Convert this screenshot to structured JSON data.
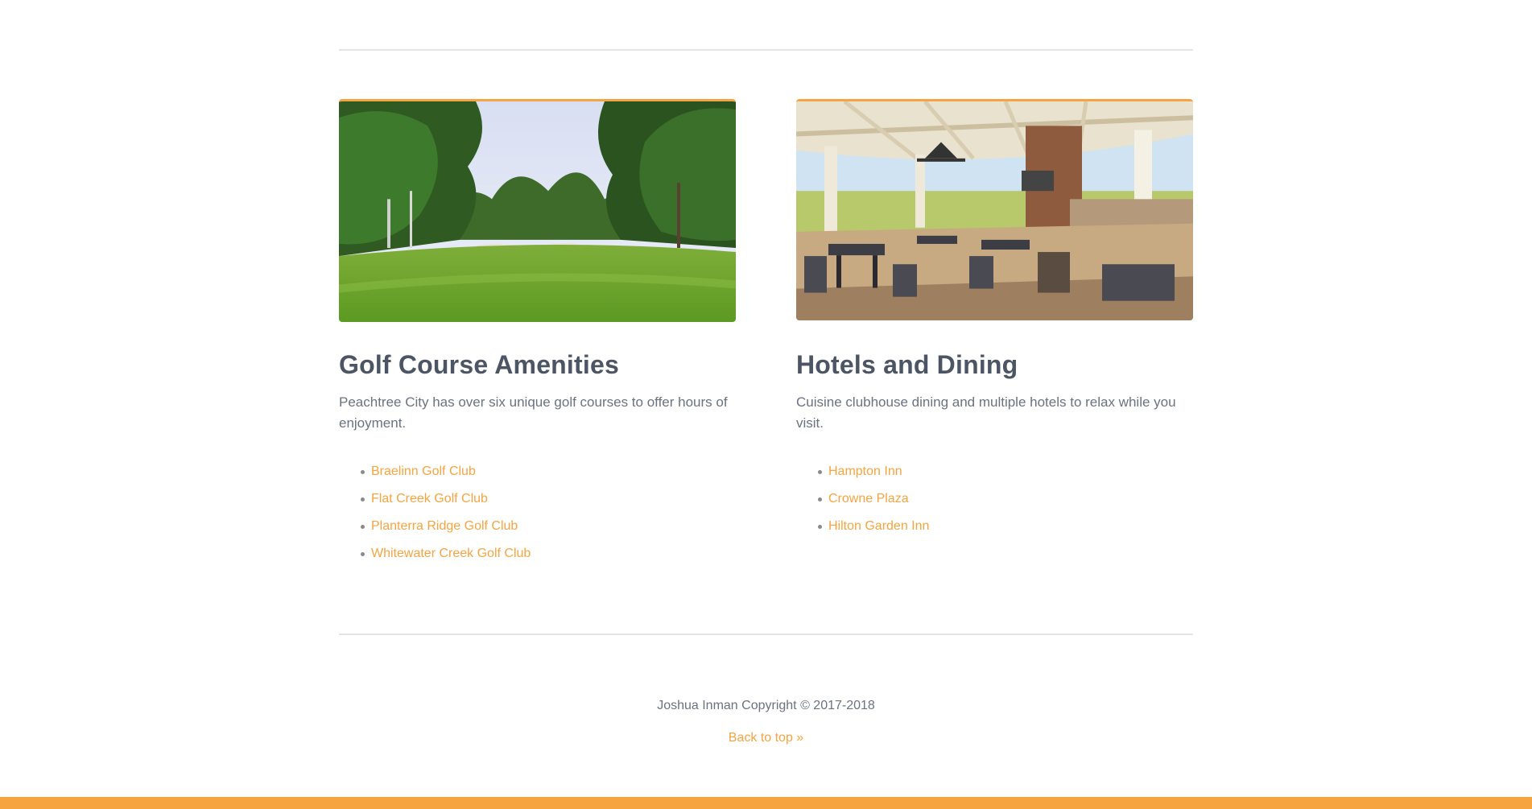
{
  "golf": {
    "title": "Golf Course Amenities",
    "description": "Peachtree City has over six unique golf courses to offer hours of enjoyment.",
    "links": [
      "Braelinn Golf Club",
      "Flat Creek Golf Club",
      "Planterra Ridge Golf Club",
      "Whitewater Creek Golf Club"
    ]
  },
  "dining": {
    "title": "Hotels and Dining",
    "description": "Cuisine clubhouse dining and multiple hotels to relax while you visit.",
    "links": [
      "Hampton Inn",
      "Crowne Plaza",
      "Hilton Garden Inn"
    ]
  },
  "footer": {
    "copyright": "Joshua Inman Copyright © 2017-2018",
    "back_to_top": "Back to top »"
  },
  "colors": {
    "accent": "#f6a440",
    "heading": "#4b5563",
    "body_text": "#6b7280",
    "divider": "#e3e3e3"
  }
}
